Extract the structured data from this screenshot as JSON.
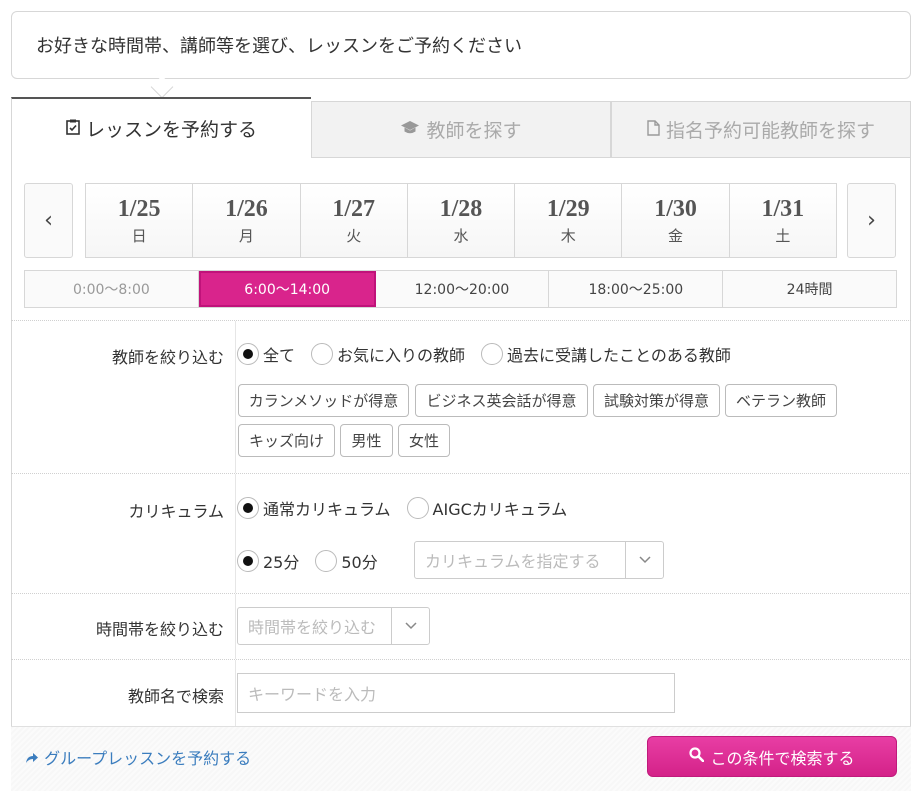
{
  "header": {
    "message": "お好きな時間帯、講師等を選び、レッスンをご予約ください"
  },
  "tabs": [
    {
      "label": "レッスンを予約する",
      "icon": "clipboard-check-icon"
    },
    {
      "label": "教師を探す",
      "icon": "graduation-cap-icon"
    },
    {
      "label": "指名予約可能教師を探す",
      "icon": "document-icon"
    }
  ],
  "dates": [
    {
      "date": "1/25",
      "day": "日"
    },
    {
      "date": "1/26",
      "day": "月"
    },
    {
      "date": "1/27",
      "day": "火"
    },
    {
      "date": "1/28",
      "day": "水"
    },
    {
      "date": "1/29",
      "day": "木"
    },
    {
      "date": "1/30",
      "day": "金"
    },
    {
      "date": "1/31",
      "day": "土"
    }
  ],
  "nav": {
    "prev": "‹",
    "next": "›"
  },
  "time_slots": [
    "0:00〜8:00",
    "6:00〜14:00",
    "12:00〜20:00",
    "18:00〜25:00",
    "24時間"
  ],
  "teacher_filter": {
    "label": "教師を絞り込む",
    "options": [
      "全て",
      "お気に入りの教師",
      "過去に受講したことのある教師"
    ],
    "tags": [
      "カランメソッドが得意",
      "ビジネス英会話が得意",
      "試験対策が得意",
      "ベテラン教師",
      "キッズ向け",
      "男性",
      "女性"
    ]
  },
  "curriculum": {
    "label": "カリキュラム",
    "types": [
      "通常カリキュラム",
      "AIGCカリキュラム"
    ],
    "durations": [
      "25分",
      "50分"
    ],
    "select_placeholder": "カリキュラムを指定する"
  },
  "time_filter": {
    "label": "時間帯を絞り込む",
    "placeholder": "時間帯を絞り込む"
  },
  "name_search": {
    "label": "教師名で検索",
    "placeholder": "キーワードを入力"
  },
  "footer": {
    "group_link": "グループレッスンを予約する",
    "search_button": "この条件で検索する"
  },
  "colors": {
    "accent": "#d9248c",
    "link": "#3b7dbe"
  }
}
